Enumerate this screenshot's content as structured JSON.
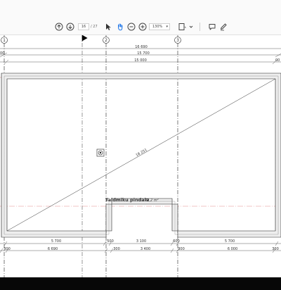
{
  "toolbar": {
    "page_current": "16",
    "page_total": "/ 27",
    "zoom": "130%"
  },
  "drawing": {
    "axes": {
      "a1": "1",
      "a2": "2",
      "a3": "3"
    },
    "dims_top": {
      "overall_outer": "16 690",
      "overall_mid": "15 700",
      "overall_inner": "15 000",
      "left_stub": "00",
      "right_stub": "00"
    },
    "diagonal": "18 251",
    "room_label": "Taldmiku pindala",
    "room_area": "72,2 m²",
    "dims_bottom": {
      "row1": [
        "5 700",
        "500",
        "3 100",
        "600",
        "5 700"
      ],
      "row2_left": "300",
      "row2": [
        "6 690",
        "300",
        "3 400",
        "300",
        "6 000"
      ],
      "row2_right": "300"
    }
  }
}
